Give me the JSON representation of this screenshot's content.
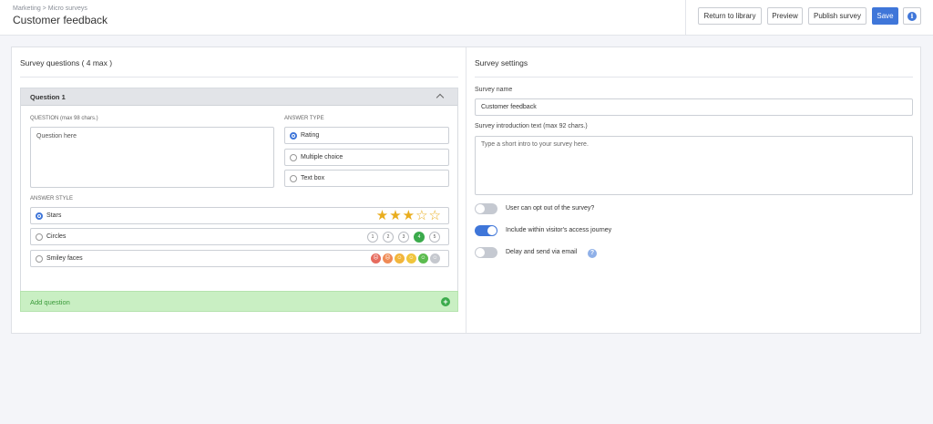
{
  "header": {
    "breadcrumb": "Marketing > Micro surveys",
    "title": "Customer feedback",
    "buttons": {
      "return": "Return to library",
      "preview": "Preview",
      "publish": "Publish survey",
      "save": "Save"
    },
    "info_icon": "i"
  },
  "questions": {
    "title": "Survey questions ( 4 max )",
    "question": {
      "title": "Question 1",
      "question_label": "QUESTION (max 98 chars.)",
      "question_placeholder": "Question here",
      "answer_type_label": "ANSWER TYPE",
      "answer_types": [
        {
          "label": "Rating",
          "selected": true
        },
        {
          "label": "Multiple choice",
          "selected": false
        },
        {
          "label": "Text box",
          "selected": false
        }
      ],
      "answer_style_label": "ANSWER STYLE",
      "answer_styles": [
        {
          "label": "Stars",
          "selected": true
        },
        {
          "label": "Circles",
          "selected": false
        },
        {
          "label": "Smiley faces",
          "selected": false
        }
      ],
      "stars": [
        "★",
        "★",
        "★",
        "☆",
        "☆"
      ],
      "circles": [
        "1",
        "2",
        "3",
        "4",
        "5"
      ],
      "circles_selected": "4",
      "faces": [
        "#e66b5e",
        "#ef8a55",
        "#f2b53b",
        "#f0c53c",
        "#5cbc4f",
        "#c5c8ce"
      ]
    },
    "add_question": "Add question",
    "add_icon": "+"
  },
  "settings": {
    "title": "Survey settings",
    "name_label": "Survey name",
    "name_value": "Customer feedback",
    "intro_label": "Survey introduction text (max 92 chars.)",
    "intro_placeholder": "Type a short intro to your survey here.",
    "toggles": [
      {
        "label": "User can opt out of the survey?",
        "on": false
      },
      {
        "label": "Include within visitor's access journey",
        "on": true
      },
      {
        "label": "Delay and send via email",
        "on": false
      }
    ],
    "help_icon": "?"
  },
  "colors": {
    "primary": "#3f76d9",
    "star": "#e9ad1e",
    "success": "#3aaa4b",
    "add_bg": "#c9efc3"
  }
}
